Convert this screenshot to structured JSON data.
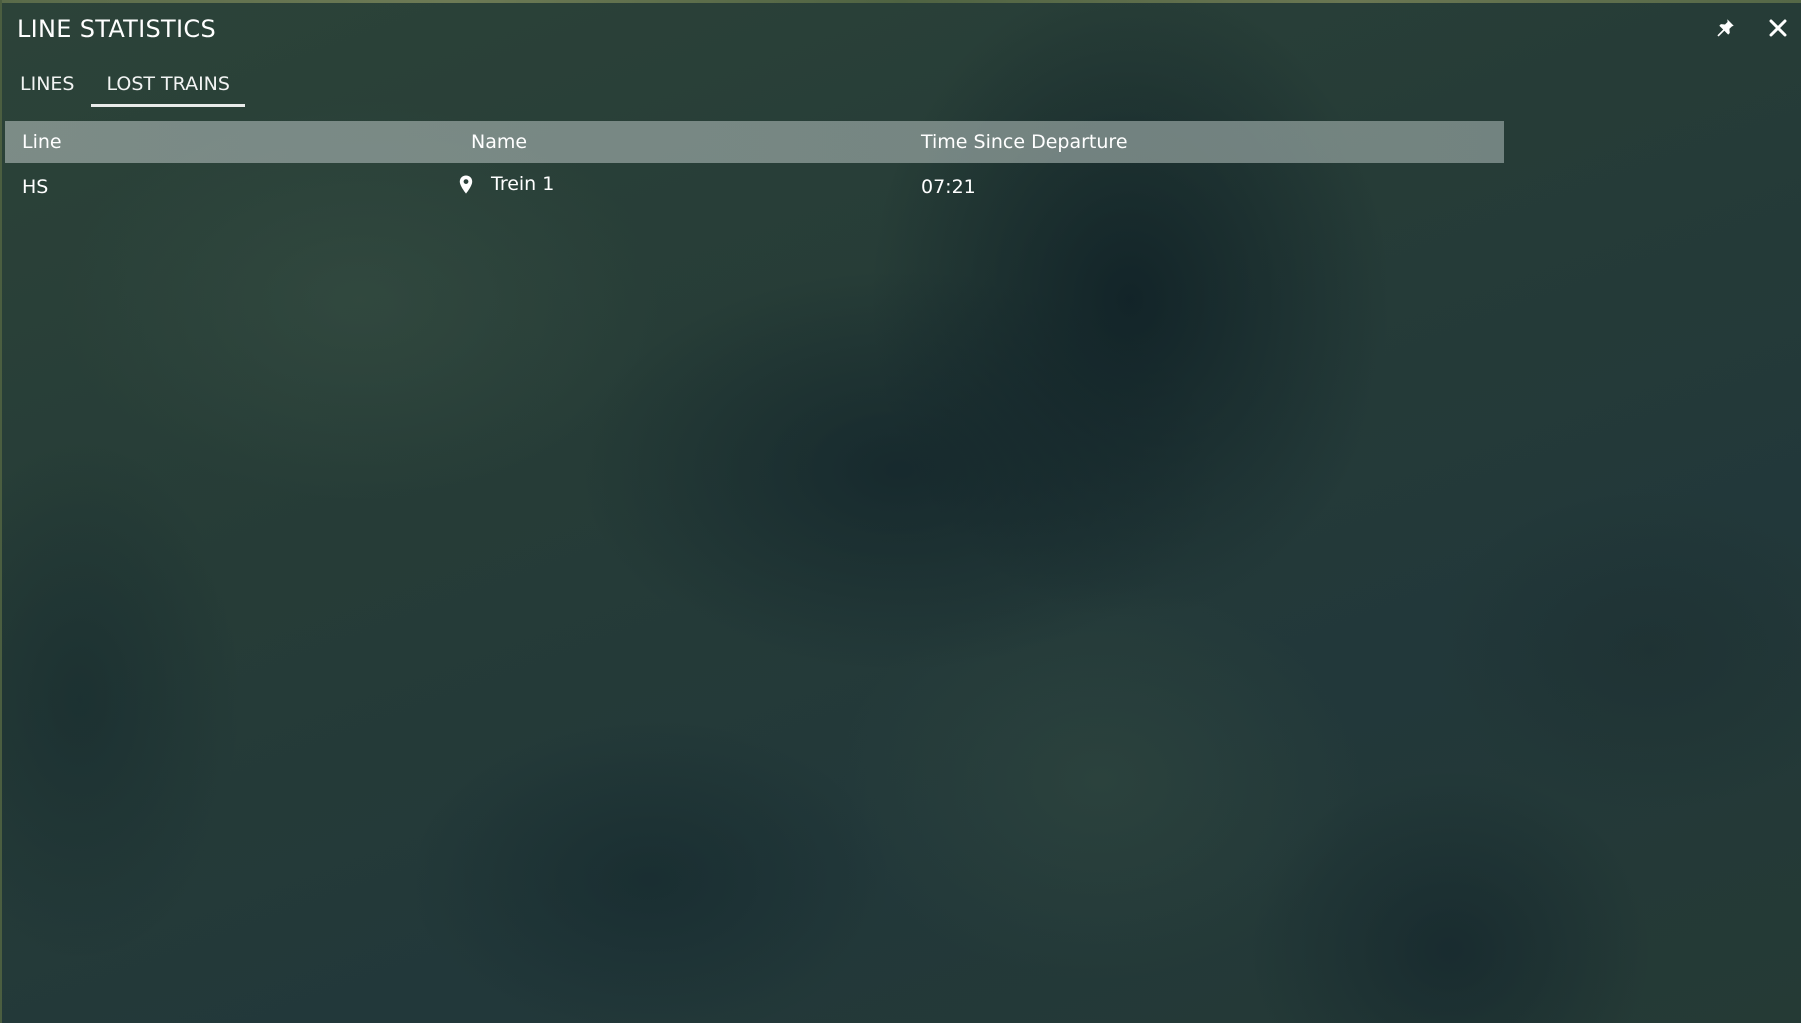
{
  "window": {
    "title": "LINE STATISTICS",
    "pin_icon": "pin-icon",
    "close_icon": "close-icon"
  },
  "tabs": [
    {
      "label": "LINES",
      "active": false
    },
    {
      "label": "LOST TRAINS",
      "active": true
    }
  ],
  "table": {
    "headers": {
      "line": "Line",
      "name": "Name",
      "time": "Time Since Departure"
    },
    "rows": [
      {
        "line": "HS",
        "name": "Trein 1",
        "time": "07:21",
        "icon": "location-pin-icon"
      }
    ]
  },
  "colors": {
    "header_bg": "#97a6a3",
    "text": "#ffffff",
    "tab_underline": "#e9ecea"
  }
}
